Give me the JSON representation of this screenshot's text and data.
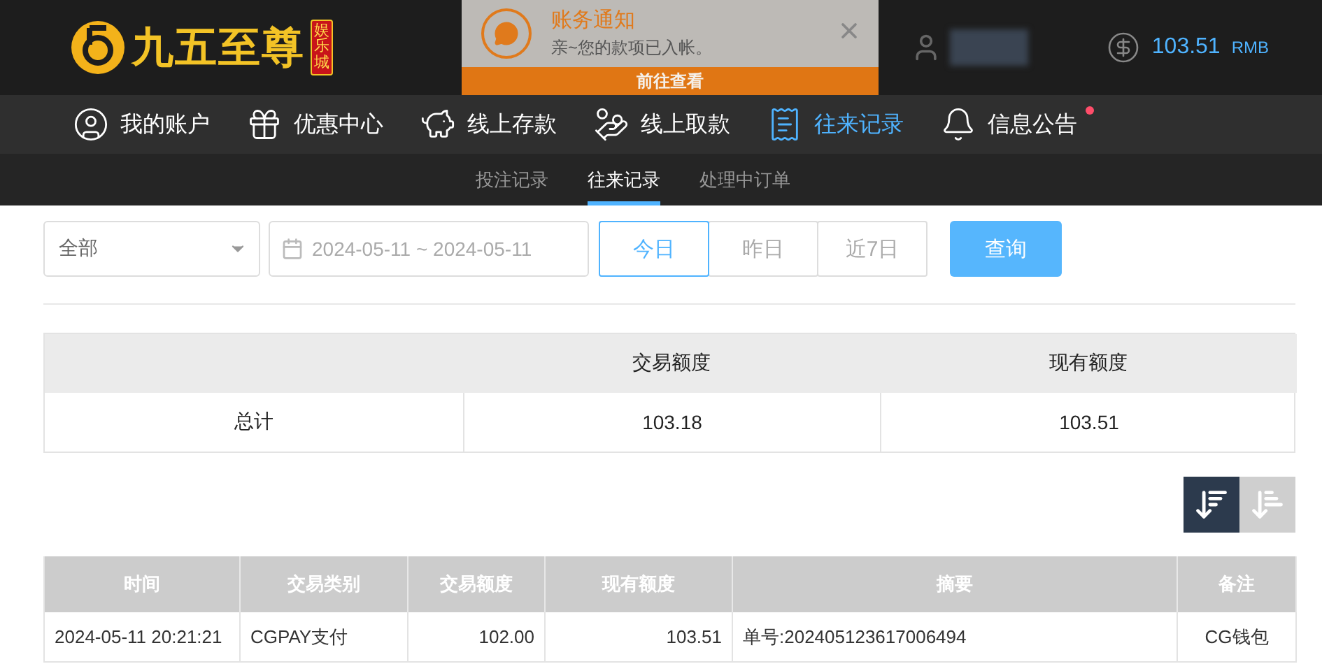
{
  "header": {
    "logo_text": "九五至尊",
    "logo_badge": "娱乐城",
    "balance": "103.51",
    "currency": "RMB"
  },
  "notification": {
    "title": "账务通知",
    "message": "亲~您的款项已入帐。",
    "action": "前往查看"
  },
  "nav": [
    {
      "label": "我的账户",
      "selected": false,
      "unread": false
    },
    {
      "label": "优惠中心",
      "selected": false,
      "unread": false
    },
    {
      "label": "线上存款",
      "selected": false,
      "unread": false
    },
    {
      "label": "线上取款",
      "selected": false,
      "unread": false
    },
    {
      "label": "往来记录",
      "selected": true,
      "unread": false
    },
    {
      "label": "信息公告",
      "selected": false,
      "unread": true
    }
  ],
  "subtabs": [
    {
      "label": "投注记录",
      "selected": false
    },
    {
      "label": "往来记录",
      "selected": true
    },
    {
      "label": "处理中订单",
      "selected": false
    }
  ],
  "filters": {
    "type": "全部",
    "date_range": "2024-05-11 ~ 2024-05-11",
    "quick_ranges": [
      {
        "label": "今日",
        "selected": true
      },
      {
        "label": "昨日",
        "selected": false
      },
      {
        "label": "近7日",
        "selected": false
      }
    ],
    "search_button": "查询"
  },
  "summary": {
    "columns": [
      "交易额度",
      "现有额度"
    ],
    "label": "总计",
    "values": [
      "103.18",
      "103.51"
    ]
  },
  "sort": [
    {
      "kind": "descending",
      "selected": true
    },
    {
      "kind": "ascending",
      "selected": false
    }
  ],
  "table": {
    "columns": [
      "时间",
      "交易类别",
      "交易额度",
      "现有额度",
      "摘要",
      "备注"
    ],
    "rows": [
      [
        "2024-05-11 20:21:21",
        "CGPAY支付",
        "102.00",
        "103.51",
        "单号:202405123617006494",
        "CG钱包"
      ]
    ]
  }
}
